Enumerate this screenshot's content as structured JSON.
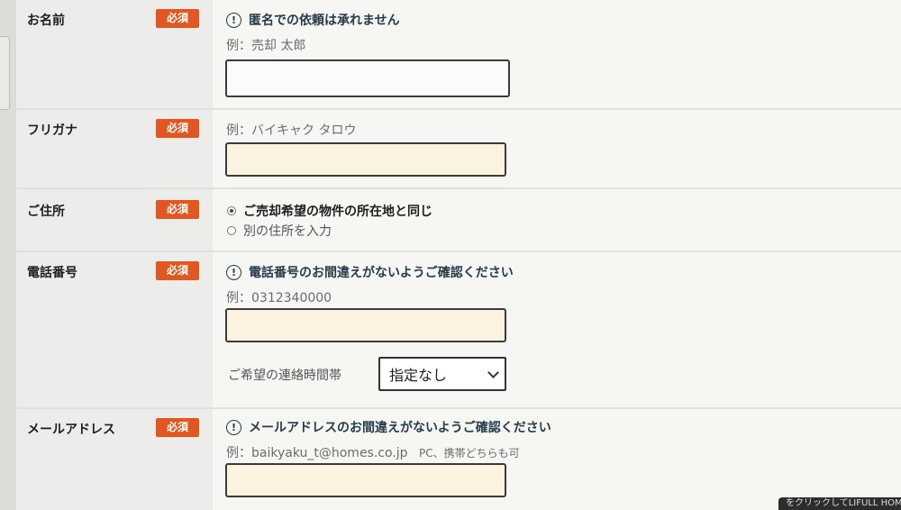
{
  "required_badge": "必須",
  "name": {
    "label": "お名前",
    "notice": "匿名での依頼は承れません",
    "example": "例：売却 太郎",
    "value": ""
  },
  "furigana": {
    "label": "フリガナ",
    "example": "例：バイキャク タロウ",
    "value": ""
  },
  "address": {
    "label": "ご住所",
    "options": [
      "ご売却希望の物件の所在地と同じ",
      "別の住所を入力"
    ],
    "selected": 0
  },
  "phone": {
    "label": "電話番号",
    "notice": "電話番号のお間違えがないようご確認ください",
    "example": "例：0312340000",
    "value": "",
    "time_label": "ご希望の連絡時間帯",
    "time_selected": "指定なし"
  },
  "email": {
    "label": "メールアドレス",
    "notice": "メールアドレスのお間違えがないようご確認ください",
    "example": "例：baikyaku_t@homes.co.jp",
    "example_note": "PC、携帯どちらも可",
    "value": ""
  },
  "banner_text": "をクリックしてLIFULL HOME'Sで"
}
